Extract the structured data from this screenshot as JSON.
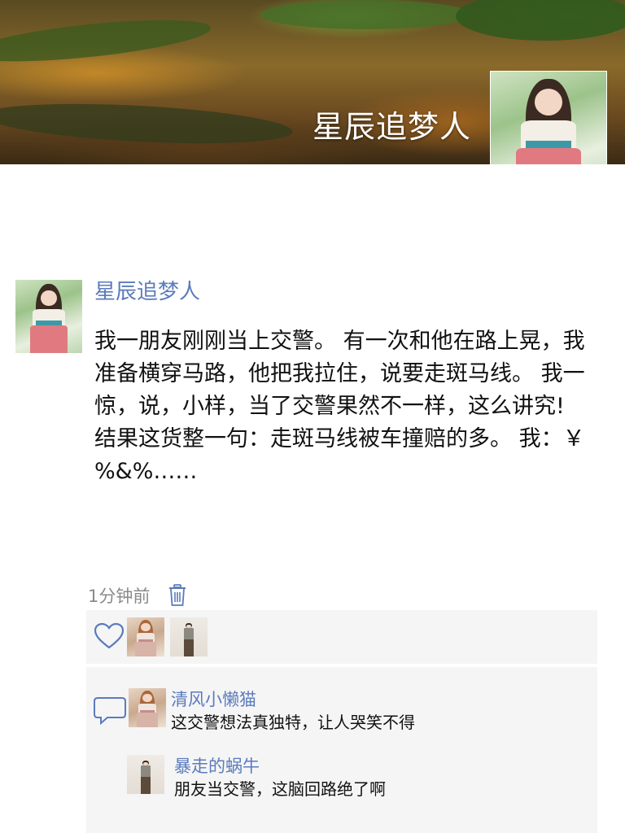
{
  "cover": {
    "title": "星辰追梦人"
  },
  "post": {
    "author": "星辰追梦人",
    "content": "我一朋友刚刚当上交警。 有一次和他在路上晃，我准备横穿马路，他把我拉住，说要走斑马线。 我一惊，说，小样，当了交警果然不一样，这么讲究! 结果这货整一句：走斑马线被车撞赔的多。 我：￥%&%……",
    "time": "1分钟前",
    "delete_icon": "trash-icon"
  },
  "likes": {
    "icon": "heart-icon",
    "users": [
      "avatar-brown-hair-girl",
      "avatar-standing-person"
    ]
  },
  "comments": {
    "icon": "comment-bubble-icon",
    "items": [
      {
        "name": "清风小懒猫",
        "text": "这交警想法真独特，让人哭笑不得"
      },
      {
        "name": "暴走的蜗牛",
        "text": "朋友当交警，这脑回路绝了啊"
      }
    ]
  },
  "colors": {
    "link_blue": "#5b7bbd",
    "text": "#111111",
    "meta_gray": "#8a8a8a",
    "panel_bg": "#f5f5f5"
  }
}
